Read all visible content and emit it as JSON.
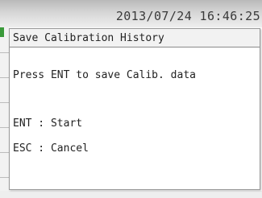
{
  "status_bar": {
    "datetime": "2013/07/24 16:46:25"
  },
  "dialog": {
    "title": "Save Calibration History",
    "message": "Press ENT to save Calib. data",
    "options": [
      {
        "label": "ENT : Start"
      },
      {
        "label": "ESC : Cancel"
      }
    ]
  },
  "colors": {
    "accent_green": "#3a9a3a",
    "status_bar_top": "#b9b9b9",
    "status_bar_bottom": "#eeeeee",
    "text": "#222222"
  }
}
